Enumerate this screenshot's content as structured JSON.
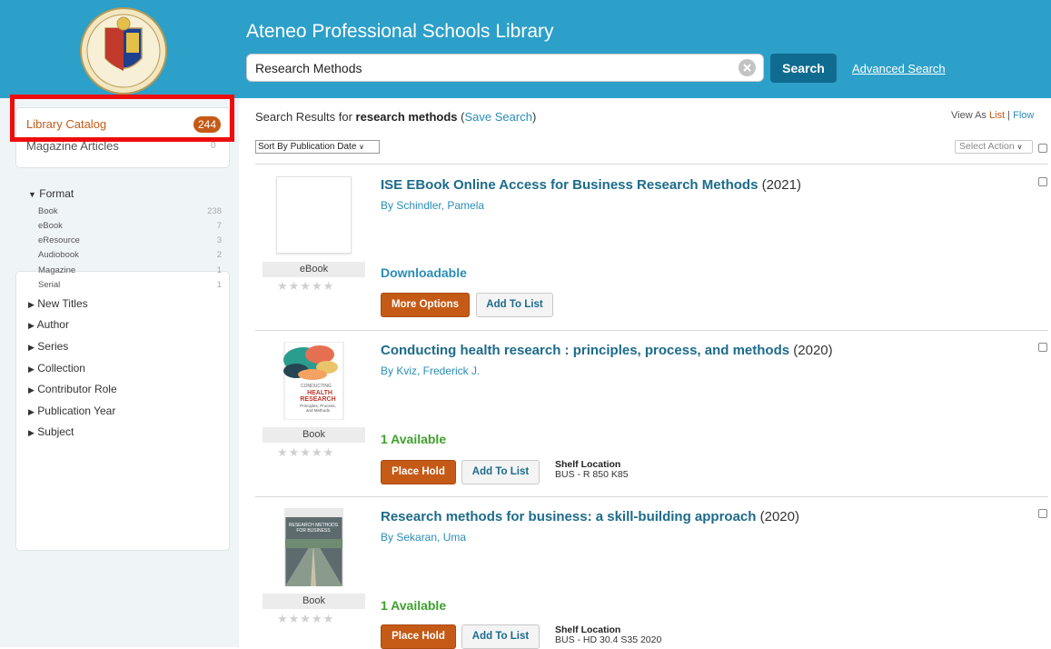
{
  "header": {
    "site_title": "Ateneo Professional Schools Library",
    "search_value": "Research Methods",
    "search_button": "Search",
    "advanced_search": "Advanced Search"
  },
  "sidebar": {
    "sources": [
      {
        "label": "Library Catalog",
        "count": "244",
        "selected": true
      },
      {
        "label": "Magazine Articles",
        "count": "0",
        "selected": false
      }
    ],
    "format_heading": "Format",
    "format_items": [
      {
        "label": "Book",
        "count": "238"
      },
      {
        "label": "eBook",
        "count": "7"
      },
      {
        "label": "eResource",
        "count": "3"
      },
      {
        "label": "Audiobook",
        "count": "2"
      },
      {
        "label": "Magazine",
        "count": "1"
      },
      {
        "label": "Serial",
        "count": "1"
      }
    ],
    "facets": [
      "New Titles",
      "Author",
      "Series",
      "Collection",
      "Contributor Role",
      "Publication Year",
      "Subject"
    ]
  },
  "results": {
    "prefix": "Search Results for ",
    "query": "research methods",
    "save_search": "Save Search",
    "view_as_label": "View As",
    "view_list": "List",
    "view_flow": "Flow",
    "sort_label": "Sort By Publication Date",
    "select_action": "Select Action",
    "items": [
      {
        "title": "ISE EBook Online Access for Business Research Methods",
        "year": "(2021)",
        "author": "By Schindler, Pamela",
        "format": "eBook",
        "availability": "Downloadable",
        "primary_button": "More Options",
        "list_button": "Add To List",
        "shelf_label": "",
        "shelf_value": ""
      },
      {
        "title": "Conducting health research : principles, process, and methods",
        "year": "(2020)",
        "author": "By Kviz, Frederick J.",
        "format": "Book",
        "availability": "1 Available",
        "primary_button": "Place Hold",
        "list_button": "Add To List",
        "shelf_label": "Shelf Location",
        "shelf_value": "BUS - R 850 K85",
        "cover_text": [
          "CONDUCTING",
          "HEALTH",
          "RESEARCH",
          "Principles, Process,",
          "and Methods"
        ]
      },
      {
        "title": "Research methods for business: a skill-building approach",
        "year": "(2020)",
        "author": "By Sekaran, Uma",
        "format": "Book",
        "availability": "1 Available",
        "primary_button": "Place Hold",
        "list_button": "Add To List",
        "shelf_label": "Shelf Location",
        "shelf_value": "BUS - HD 30.4 S35 2020",
        "cover_text": [
          "RESEARCH METHODS",
          "FOR BUSINESS"
        ]
      }
    ]
  },
  "colors": {
    "header_bg": "#2ca0c9",
    "accent_orange": "#c55a16",
    "link_blue": "#2a8db8",
    "available_green": "#3da12c",
    "highlight_red": "#ee0d0d"
  }
}
